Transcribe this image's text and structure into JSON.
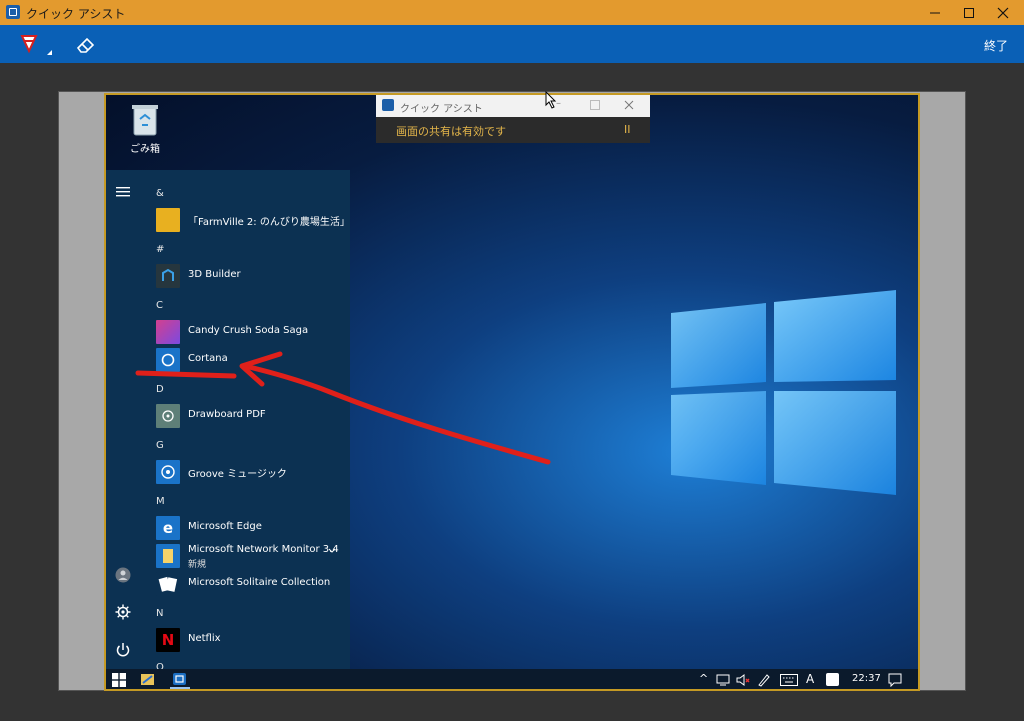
{
  "window": {
    "title": "クイック アシスト"
  },
  "toolbar": {
    "finish_label": "終了"
  },
  "desktop": {
    "recycle_label": "ごみ箱",
    "quick_assist_mini": {
      "title": "クイック アシスト",
      "status": "画面の共有は有効です",
      "pause": "II"
    },
    "start_menu": {
      "headers": [
        "&",
        "#",
        "C",
        "D",
        "G",
        "M",
        "N",
        "O"
      ],
      "apps": {
        "farmville": "「FarmVille 2: のんびり農場生活」",
        "builder3d": "3D Builder",
        "candy": "Candy Crush Soda Saga",
        "cortana": "Cortana",
        "drawboard": "Drawboard PDF",
        "groove": "Groove ミュージック",
        "edge": "Microsoft Edge",
        "netmon": "Microsoft Network Monitor 3.4",
        "netmon_sub": "新規",
        "solitaire": "Microsoft Solitaire Collection",
        "netflix": "Netflix"
      }
    },
    "taskbar": {
      "clock": "22:37",
      "ime": "A"
    }
  },
  "colors": {
    "titlebar": "#e39a2e",
    "toolbar": "#0a60b6",
    "annotation": "#e0201a",
    "highlight_border": "#c59a24"
  }
}
